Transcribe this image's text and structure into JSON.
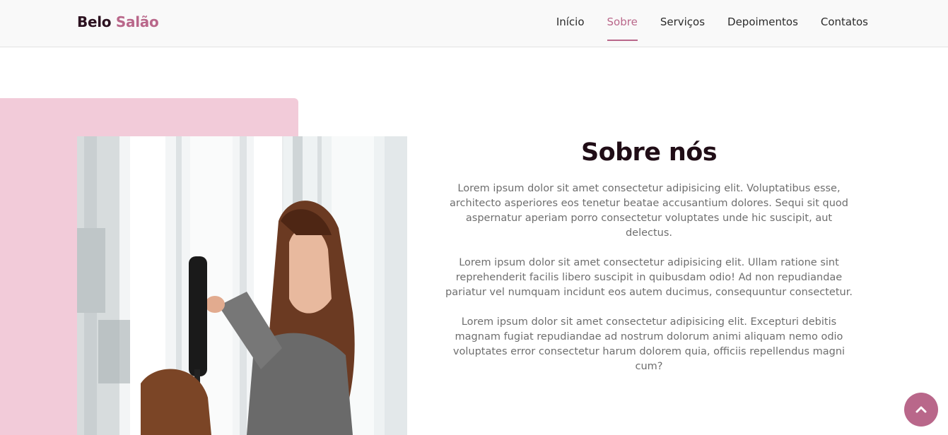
{
  "brand": {
    "first": "Belo",
    "second": "Salão"
  },
  "nav": {
    "items": [
      {
        "label": "Início",
        "active": false
      },
      {
        "label": "Sobre",
        "active": true
      },
      {
        "label": "Serviços",
        "active": false
      },
      {
        "label": "Depoimentos",
        "active": false
      },
      {
        "label": "Contatos",
        "active": false
      }
    ]
  },
  "about": {
    "title": "Sobre nós",
    "paragraphs": [
      "Lorem ipsum dolor sit amet consectetur adipisicing elit. Voluptatibus esse, architecto asperiores eos tenetur beatae accusantium dolores. Sequi sit quod aspernatur aperiam porro consectetur voluptates unde hic suscipit, aut delectus.",
      "Lorem ipsum dolor sit amet consectetur adipisicing elit. Ullam ratione sint reprehenderit facilis libero suscipit in quibusdam odio! Ad non repudiandae pariatur vel numquam incidunt eos autem ducimus, consequuntur consectetur.",
      "Lorem ipsum dolor sit amet consectetur adipisicing elit. Excepturi debitis magnam fugiat repudiandae ad nostrum dolorum animi aliquam nemo odio voluptates error consectetur harum dolorem quia, officiis repellendus magni cum?"
    ]
  },
  "colors": {
    "accent": "#b9678a",
    "pink_block": "#f2cbd9",
    "title": "#200d16"
  },
  "icons": {
    "back_to_top": "chevron-up-icon"
  }
}
